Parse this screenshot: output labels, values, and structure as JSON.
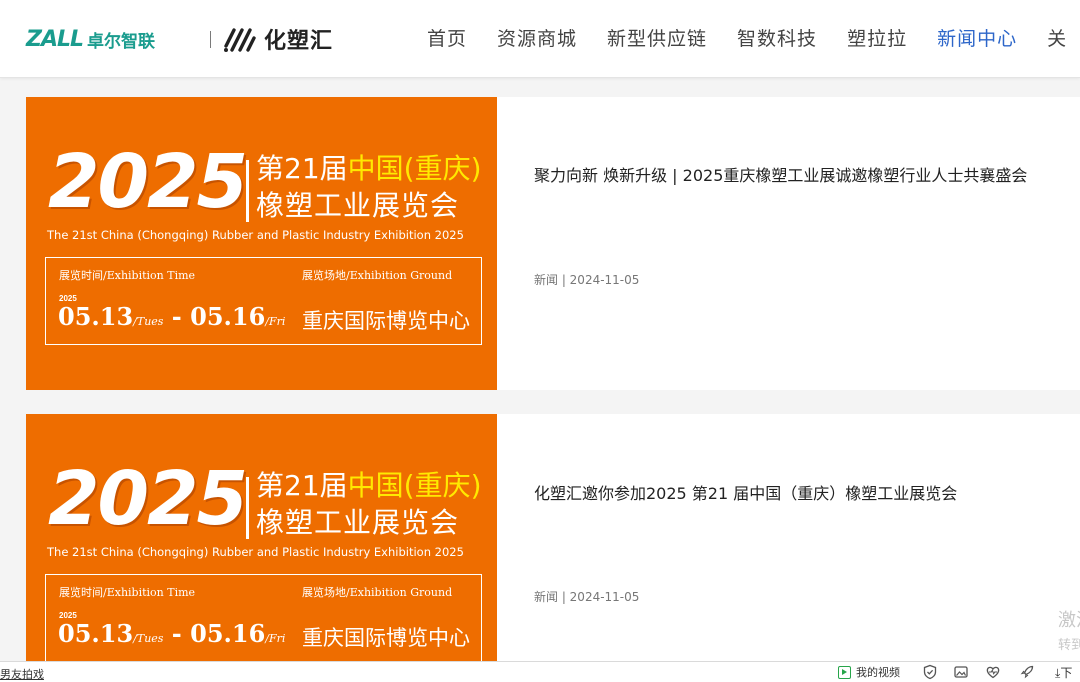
{
  "header": {
    "logo_zall": "ZALL",
    "logo_zall_cn": "卓尔智联",
    "logo_hsh": "化塑汇",
    "nav": [
      {
        "label": "首页",
        "active": false
      },
      {
        "label": "资源商城",
        "active": false
      },
      {
        "label": "新型供应链",
        "active": false
      },
      {
        "label": "智数科技",
        "active": false
      },
      {
        "label": "塑拉拉",
        "active": false
      },
      {
        "label": "新闻中心",
        "active": true
      },
      {
        "label": "关",
        "active": false
      }
    ]
  },
  "thumbnail": {
    "year": "2025",
    "line1_white": "第21届",
    "line1_yellow": "中国(重庆)",
    "line2": "橡塑工业展览会",
    "english": "The 21st China (Chongqing) Rubber and Plastic Industry Exhibition 2025",
    "time_label": "展览时间/Exhibition Time",
    "ground_label": "展览场地/Exhibition Ground",
    "small_year": "2025",
    "date_start": "05.13",
    "day_start": "/Tues",
    "date_sep": " - ",
    "date_end": "05.16",
    "day_end": "/Fri",
    "venue": "重庆国际博览中心"
  },
  "articles": [
    {
      "title": "聚力向新 焕新升级 | 2025重庆橡塑工业展诚邀橡塑行业人士共襄盛会",
      "meta": "新闻 | 2024-11-05"
    },
    {
      "title": "化塑汇邀你参加2025 第21 届中国（重庆）橡塑工业展览会",
      "meta": "新闻 | 2024-11-05"
    }
  ],
  "watermark": {
    "line1": "激活",
    "line2": "转到"
  },
  "bottombar": {
    "left_link": "男友拍戏",
    "video_label": "我的视频",
    "download_label": "下"
  },
  "colors": {
    "brand": "#1a9c8e",
    "nav_active": "#2d66c9",
    "thumb_bg": "#ee6d00",
    "thumb_highlight": "#ffe900"
  }
}
